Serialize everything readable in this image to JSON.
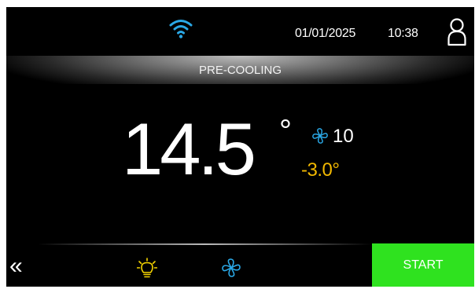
{
  "header": {
    "wifi_icon": "wifi-icon",
    "date": "01/01/2025",
    "time": "10:38",
    "user_icon": "user-icon"
  },
  "status": {
    "label": "PRE-COOLING"
  },
  "main": {
    "temperature": "14.5",
    "degree_symbol": "°",
    "fan_icon": "fan-icon",
    "fan_speed": "10",
    "setpoint": "-3.0°"
  },
  "footer": {
    "back_label": "«",
    "light_icon": "lightbulb-icon",
    "fan_icon": "fan-icon",
    "start_label": "START"
  },
  "colors": {
    "background": "#000000",
    "accent_blue": "#2aa8e6",
    "setpoint_yellow": "#f2b800",
    "light_icon_yellow": "#f5d400",
    "start_green": "#2fe21f"
  }
}
